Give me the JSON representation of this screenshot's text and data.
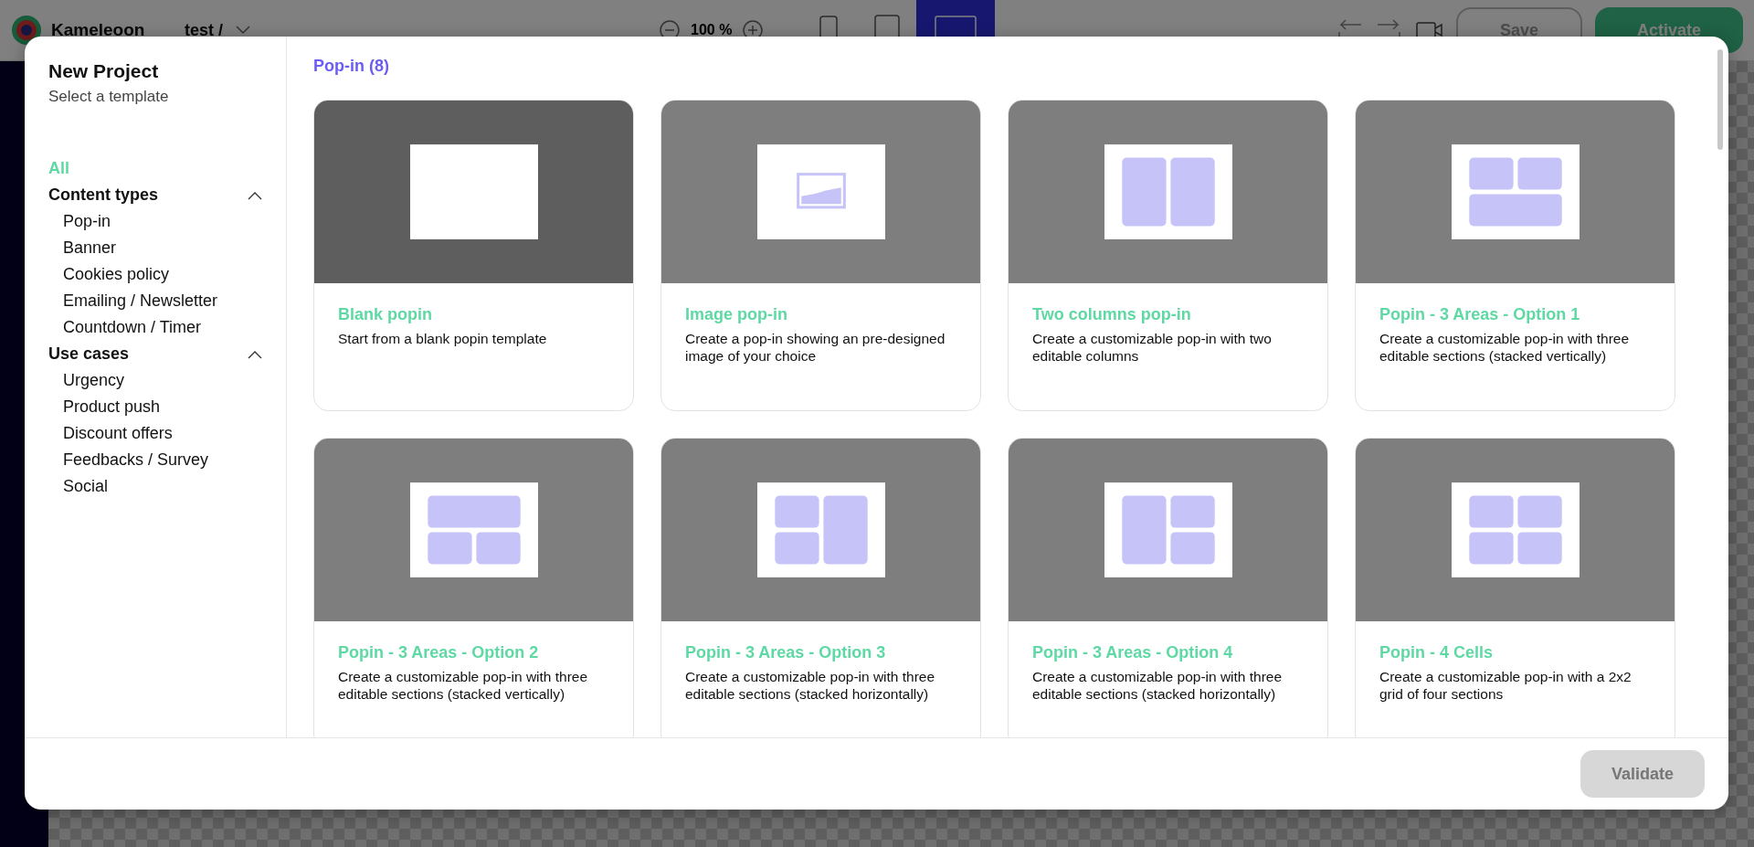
{
  "app": {
    "logo": "Kameleoon",
    "breadcrumb": "test /",
    "zoom": "100 %",
    "buttons": [
      {
        "label": "Save",
        "kind": "outline"
      },
      {
        "label": "Activate",
        "kind": "primary"
      }
    ]
  },
  "modal": {
    "title": "New Project",
    "subtitle": "Select a template",
    "filters": {
      "all": {
        "label": "All",
        "selected": true
      },
      "groups": [
        {
          "label": "Content types",
          "expanded": true,
          "items": [
            {
              "label": "Pop-in",
              "selected": false
            },
            {
              "label": "Banner",
              "selected": false
            },
            {
              "label": "Cookies policy",
              "selected": false
            },
            {
              "label": "Emailing / Newsletter",
              "selected": false
            },
            {
              "label": "Countdown / Timer",
              "selected": false
            }
          ]
        },
        {
          "label": "Use cases",
          "expanded": true,
          "items": [
            {
              "label": "Urgency",
              "selected": false
            },
            {
              "label": "Product push",
              "selected": false
            },
            {
              "label": "Discount offers",
              "selected": false
            },
            {
              "label": "Feedbacks / Survey",
              "selected": false
            },
            {
              "label": "Social",
              "selected": false
            }
          ]
        }
      ]
    },
    "section": "Pop-in (8)",
    "templates": [
      {
        "title": "Blank popin",
        "description": "Start from a blank popin template",
        "kind": "blank",
        "hovered": true
      },
      {
        "title": "Image pop-in",
        "description": "Create a pop-in showing an pre-designed image of your choice",
        "kind": "image",
        "hovered": false
      },
      {
        "title": "Two columns pop-in",
        "description": "Create a customizable pop-in with two editable columns",
        "kind": "two-columns",
        "hovered": false
      },
      {
        "title": "Popin - 3 Areas - Option 1",
        "description": "Create a customizable pop-in with three editable sections (stacked vertically)",
        "kind": "two-top-one-bottom",
        "hovered": false
      },
      {
        "title": "Popin - 3 Areas - Option 2",
        "description": "Create a customizable pop-in with three editable sections (stacked vertically)",
        "kind": "one-top-two-bottom",
        "hovered": false
      },
      {
        "title": "Popin - 3 Areas - Option 3",
        "description": "Create a customizable pop-in with three editable sections (stacked horizontally)",
        "kind": "two-left-one-right",
        "hovered": false
      },
      {
        "title": "Popin - 3 Areas - Option 4",
        "description": "Create a customizable pop-in with three editable sections (stacked horizontally)",
        "kind": "one-left-two-right",
        "hovered": false
      },
      {
        "title": "Popin - 4 Cells",
        "description": "Create a customizable pop-in with a 2x2 grid of four sections",
        "kind": "four-cells",
        "hovered": false
      }
    ],
    "validate": {
      "label": "Validate",
      "disabled": true
    }
  }
}
